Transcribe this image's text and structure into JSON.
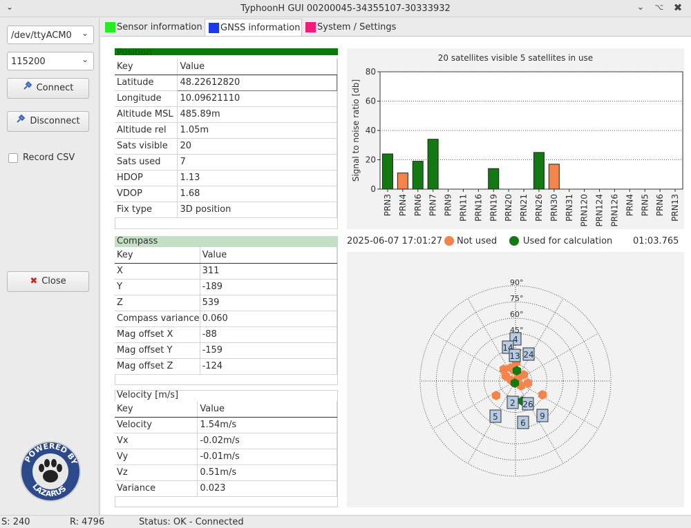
{
  "window": {
    "title": "TyphoonH GUI  00200045-34355107-30333932"
  },
  "sidebar": {
    "port": "/dev/ttyACM0",
    "baud": "115200",
    "connect_label": "Connect",
    "disconnect_label": "Disconnect",
    "record_label": "Record CSV",
    "close_label": "Close",
    "logo_text": "POWERED BY LAZARUS"
  },
  "tabs": [
    {
      "label": "Sensor information",
      "color": "#22ee22"
    },
    {
      "label": "GNSS information",
      "color": "#1c3ae8"
    },
    {
      "label": "System / Settings",
      "color": "#f21a7a"
    }
  ],
  "position": {
    "title": "Position",
    "cols": [
      "Key",
      "Value"
    ],
    "rows": [
      [
        "Latitude",
        "48.22612820"
      ],
      [
        "Longitude",
        "10.09621110"
      ],
      [
        "Altitude MSL",
        "485.89m"
      ],
      [
        "Altitude rel",
        "1.05m"
      ],
      [
        "Sats visible",
        "20"
      ],
      [
        "Sats used",
        "7"
      ],
      [
        "HDOP",
        "1.13"
      ],
      [
        "VDOP",
        "1.68"
      ],
      [
        "Fix type",
        "3D position"
      ]
    ]
  },
  "compass": {
    "title": "Compass",
    "cols": [
      "Key",
      "Value"
    ],
    "rows": [
      [
        "X",
        "311"
      ],
      [
        "Y",
        "-189"
      ],
      [
        "Z",
        "539"
      ],
      [
        "Compass variance",
        "0.060"
      ],
      [
        "Mag offset X",
        "-88"
      ],
      [
        "Mag offset Y",
        "-159"
      ],
      [
        "Mag offset Z",
        "-124"
      ]
    ]
  },
  "velocity": {
    "title": "Velocity [m/s]",
    "cols": [
      "Key",
      "Value"
    ],
    "rows": [
      [
        "Velocity",
        "1.54m/s"
      ],
      [
        "Vx",
        "-0.02m/s"
      ],
      [
        "Vy",
        "-0.01m/s"
      ],
      [
        "Vz",
        "0.51m/s"
      ],
      [
        "Variance",
        "0.023"
      ]
    ]
  },
  "chart_data": {
    "type": "bar",
    "title": "20 satellites visible  5 satellites in use",
    "ylabel": "Signal to noise ratio [db]",
    "xlabel": "",
    "ylim": [
      0,
      80
    ],
    "yticks": [
      0,
      20,
      40,
      60,
      80
    ],
    "grid": true,
    "categories": [
      "PRN3",
      "PRN4",
      "PRN6",
      "PRN7",
      "PRN9",
      "PRN11",
      "PRN16",
      "PRN19",
      "PRN20",
      "PRN21",
      "PRN26",
      "PRN30",
      "PRN31",
      "PRN120",
      "PRN124",
      "PRN126",
      "PRN4",
      "PRN5",
      "PRN6",
      "PRN13"
    ],
    "values": [
      24,
      11,
      19,
      34,
      0,
      0,
      0,
      14,
      0,
      0,
      25,
      17,
      0,
      0,
      0,
      0,
      0,
      0,
      0,
      0
    ],
    "used": [
      true,
      false,
      true,
      true,
      false,
      false,
      false,
      true,
      false,
      false,
      true,
      false,
      false,
      false,
      false,
      false,
      false,
      false,
      false,
      false
    ],
    "colors": {
      "used": "#137a13",
      "not_used": "#f4844a"
    }
  },
  "legend": {
    "datetime": "2025-06-07 17:01:27",
    "not_used_label": "Not used",
    "used_label": "Used for calculation",
    "elapsed": "01:03.765"
  },
  "skyplot": {
    "elevation_labels": [
      "90°",
      "75°",
      "60°",
      "45°"
    ],
    "sat_labels": [
      "4",
      "14",
      "13",
      "24",
      "2",
      "26",
      "5",
      "6",
      "9"
    ]
  },
  "status": {
    "s": "S: 240",
    "r": "R: 4796",
    "text": "Status: OK  -  Connected"
  }
}
